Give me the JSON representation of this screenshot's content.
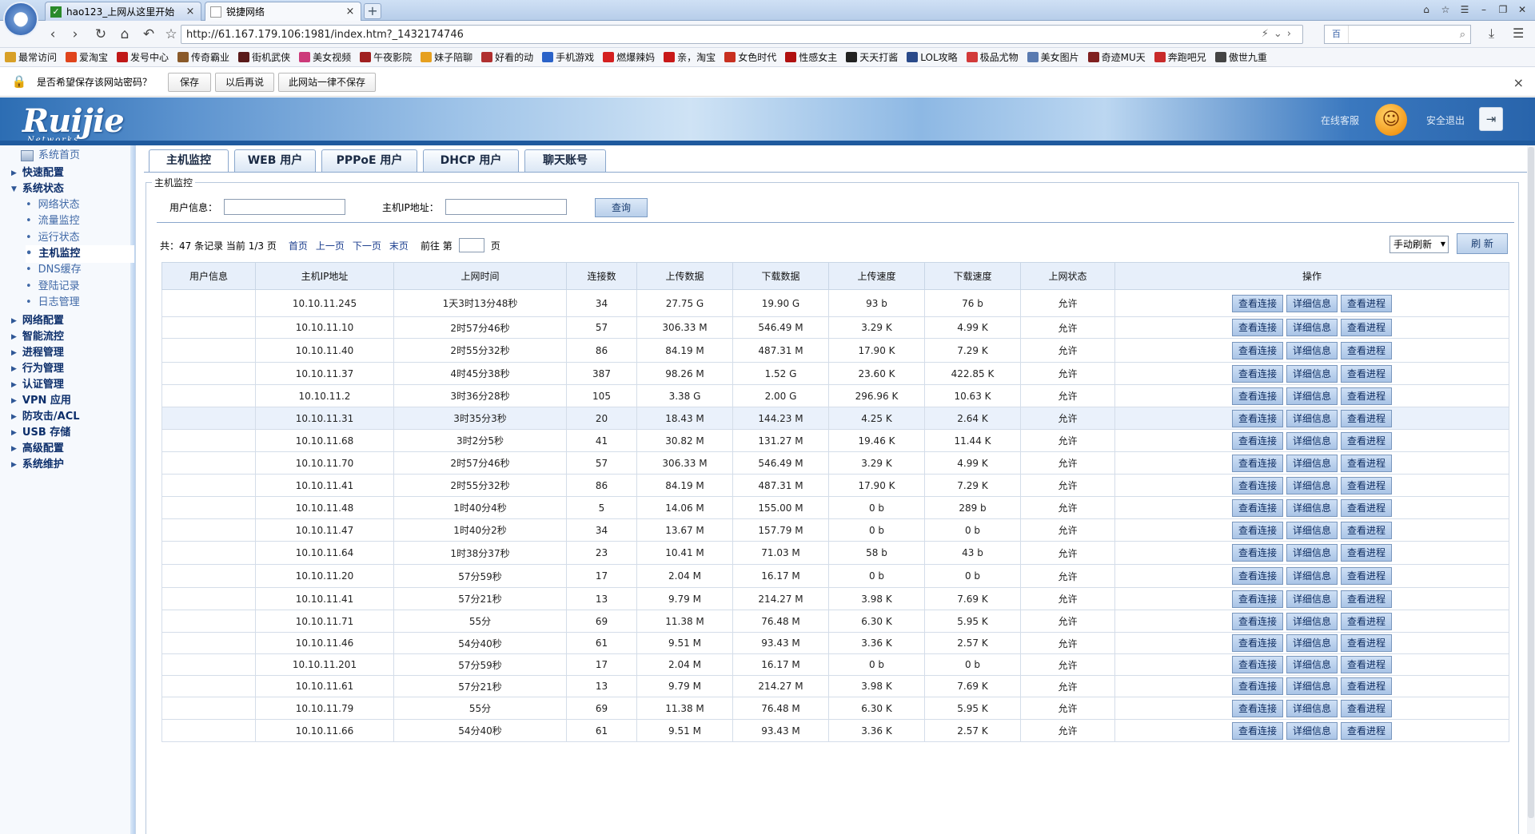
{
  "browser": {
    "tabs": [
      {
        "title": "hao123_上网从这里开始",
        "close": "×"
      },
      {
        "title": "锐捷网络",
        "close": "×"
      }
    ],
    "new_tab": "+",
    "url": "http://61.167.179.106:1981/index.htm?_1432174746",
    "search_engine_label": "百",
    "nav_icons": [
      "back-icon",
      "forward-icon",
      "reload-icon",
      "home-icon",
      "undo-icon",
      "star-icon"
    ],
    "bookmarks": [
      "最常访问",
      "爱淘宝",
      "发号中心",
      "传奇霸业",
      "街机武侠",
      "美女视频",
      "午夜影院",
      "妹子陪聊",
      "好看的动",
      "手机游戏",
      "燃爆辣妈",
      "亲，淘宝",
      "女色时代",
      "性感女主",
      "天天打酱",
      "LOL攻略",
      "极品尤物",
      "美女图片",
      "奇迹MU天",
      "奔跑吧兄",
      "傲世九重"
    ],
    "bookmark_colors": [
      "#d8a028",
      "#e0441c",
      "#c01818",
      "#8a5a2a",
      "#5a1a1a",
      "#cc3a7a",
      "#a02020",
      "#e6a020",
      "#b03030",
      "#2a62c8",
      "#d42020",
      "#c81818",
      "#c83020",
      "#b01010",
      "#222222",
      "#2a4a8a",
      "#d23a3a",
      "#5a7ab0",
      "#802020",
      "#c82a2a",
      "#444444"
    ]
  },
  "password_bar": {
    "prompt": "是否希望保存该网站密码？",
    "save": "保存",
    "later": "以后再说",
    "never": "此网站一律不保存",
    "close": "×"
  },
  "header": {
    "logo": "Ruijie",
    "logo_sub": "Networks",
    "online_service": "在线客服",
    "safe_exit": "安全退出"
  },
  "sidebar": {
    "home": "系统首页",
    "items": [
      {
        "label": "快速配置",
        "open": false
      },
      {
        "label": "系统状态",
        "open": true
      },
      {
        "label": "网络配置",
        "open": false
      },
      {
        "label": "智能流控",
        "open": false
      },
      {
        "label": "进程管理",
        "open": false
      },
      {
        "label": "行为管理",
        "open": false
      },
      {
        "label": "认证管理",
        "open": false
      },
      {
        "label": "VPN 应用",
        "open": false
      },
      {
        "label": "防攻击/ACL",
        "open": false
      },
      {
        "label": "USB 存储",
        "open": false
      },
      {
        "label": "高级配置",
        "open": false
      },
      {
        "label": "系统维护",
        "open": false
      }
    ],
    "sub_items": [
      "网络状态",
      "流量监控",
      "运行状态",
      "主机监控",
      "DNS缓存",
      "登陆记录",
      "日志管理"
    ],
    "active_sub": "主机监控"
  },
  "content": {
    "tabs": [
      "主机监控",
      "WEB 用户",
      "PPPoE 用户",
      "DHCP 用户",
      "聊天账号"
    ],
    "legend": "主机监控",
    "user_info_label": "用户信息：",
    "host_ip_label": "主机IP地址：",
    "query_button": "查询",
    "pager": {
      "total": "共：47 条记录",
      "current": "当前 1/3 页",
      "first": "首页",
      "prev": "上一页",
      "next": "下一页",
      "last": "末页",
      "goto_prefix": "前往 第",
      "goto_suffix": "页"
    },
    "refresh_mode": "手动刷新",
    "refresh_button": "刷 新",
    "columns": [
      "用户信息",
      "主机IP地址",
      "上网时间",
      "连接数",
      "上传数据",
      "下载数据",
      "上传速度",
      "下载速度",
      "上网状态",
      "操作"
    ],
    "action_labels": [
      "查看连接",
      "详细信息",
      "查看进程"
    ],
    "rows": [
      [
        "",
        "10.10.11.245",
        "1天3时13分48秒",
        "34",
        "27.75 G",
        "19.90 G",
        "93 b",
        "76 b",
        "允许"
      ],
      [
        "",
        "10.10.11.10",
        "2时57分46秒",
        "57",
        "306.33 M",
        "546.49 M",
        "3.29 K",
        "4.99 K",
        "允许"
      ],
      [
        "",
        "10.10.11.40",
        "2时55分32秒",
        "86",
        "84.19 M",
        "487.31 M",
        "17.90 K",
        "7.29 K",
        "允许"
      ],
      [
        "",
        "10.10.11.37",
        "4时45分38秒",
        "387",
        "98.26 M",
        "1.52 G",
        "23.60 K",
        "422.85 K",
        "允许"
      ],
      [
        "",
        "10.10.11.2",
        "3时36分28秒",
        "105",
        "3.38 G",
        "2.00 G",
        "296.96 K",
        "10.63 K",
        "允许"
      ],
      [
        "",
        "10.10.11.31",
        "3时35分3秒",
        "20",
        "18.43 M",
        "144.23 M",
        "4.25 K",
        "2.64 K",
        "允许"
      ],
      [
        "",
        "10.10.11.68",
        "3时2分5秒",
        "41",
        "30.82 M",
        "131.27 M",
        "19.46 K",
        "11.44 K",
        "允许"
      ],
      [
        "",
        "10.10.11.70",
        "2时57分46秒",
        "57",
        "306.33 M",
        "546.49 M",
        "3.29 K",
        "4.99 K",
        "允许"
      ],
      [
        "",
        "10.10.11.41",
        "2时55分32秒",
        "86",
        "84.19 M",
        "487.31 M",
        "17.90 K",
        "7.29 K",
        "允许"
      ],
      [
        "",
        "10.10.11.48",
        "1时40分4秒",
        "5",
        "14.06 M",
        "155.00 M",
        "0 b",
        "289 b",
        "允许"
      ],
      [
        "",
        "10.10.11.47",
        "1时40分2秒",
        "34",
        "13.67 M",
        "157.79 M",
        "0 b",
        "0 b",
        "允许"
      ],
      [
        "",
        "10.10.11.64",
        "1时38分37秒",
        "23",
        "10.41 M",
        "71.03 M",
        "58 b",
        "43 b",
        "允许"
      ],
      [
        "",
        "10.10.11.20",
        "57分59秒",
        "17",
        "2.04 M",
        "16.17 M",
        "0 b",
        "0 b",
        "允许"
      ],
      [
        "",
        "10.10.11.41",
        "57分21秒",
        "13",
        "9.79 M",
        "214.27 M",
        "3.98 K",
        "7.69 K",
        "允许"
      ],
      [
        "",
        "10.10.11.71",
        "55分",
        "69",
        "11.38 M",
        "76.48 M",
        "6.30 K",
        "5.95 K",
        "允许"
      ],
      [
        "",
        "10.10.11.46",
        "54分40秒",
        "61",
        "9.51 M",
        "93.43 M",
        "3.36 K",
        "2.57 K",
        "允许"
      ],
      [
        "",
        "10.10.11.201",
        "57分59秒",
        "17",
        "2.04 M",
        "16.17 M",
        "0 b",
        "0 b",
        "允许"
      ],
      [
        "",
        "10.10.11.61",
        "57分21秒",
        "13",
        "9.79 M",
        "214.27 M",
        "3.98 K",
        "7.69 K",
        "允许"
      ],
      [
        "",
        "10.10.11.79",
        "55分",
        "69",
        "11.38 M",
        "76.48 M",
        "6.30 K",
        "5.95 K",
        "允许"
      ],
      [
        "",
        "10.10.11.66",
        "54分40秒",
        "61",
        "9.51 M",
        "93.43 M",
        "3.36 K",
        "2.57 K",
        "允许"
      ]
    ],
    "highlight_row": 5
  }
}
